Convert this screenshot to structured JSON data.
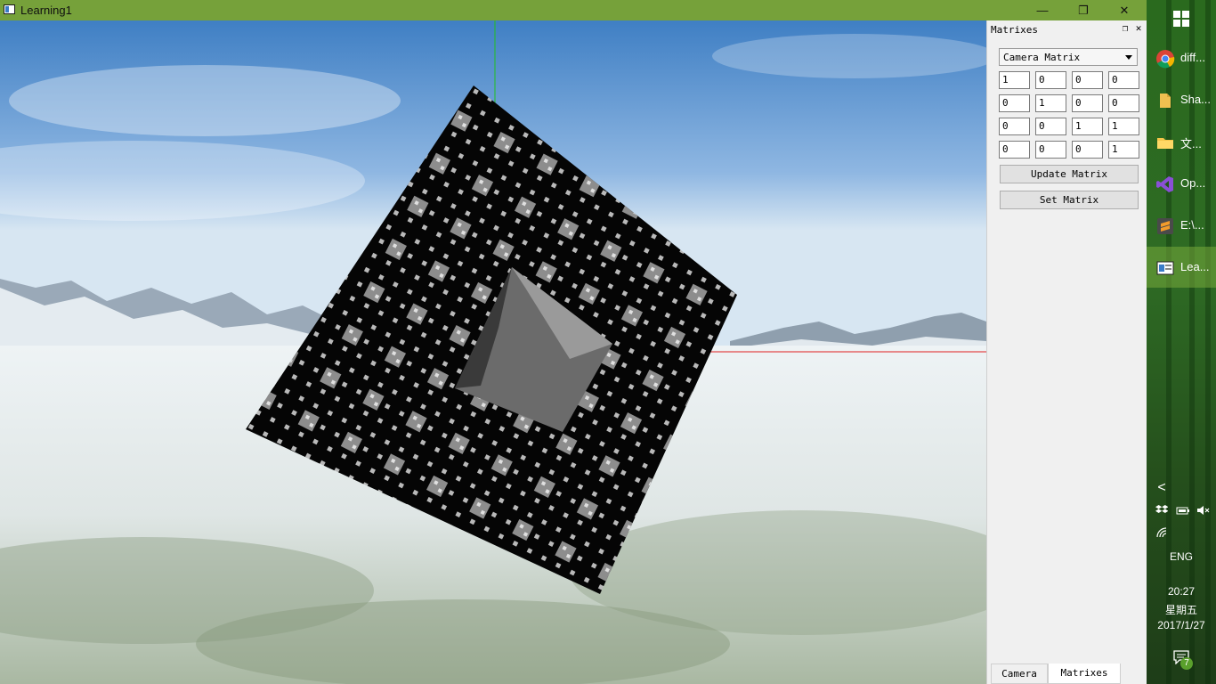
{
  "window": {
    "title": "Learning1",
    "minimize_glyph": "—",
    "maximize_glyph": "❐",
    "close_glyph": "✕"
  },
  "panel": {
    "title": "Matrixes",
    "float_glyph": "❐",
    "close_glyph": "✕",
    "dropdown": {
      "selected": "Camera Matrix"
    },
    "matrix": [
      [
        "1",
        "0",
        "0",
        "0"
      ],
      [
        "0",
        "1",
        "0",
        "0"
      ],
      [
        "0",
        "0",
        "1",
        "1"
      ],
      [
        "0",
        "0",
        "0",
        "1"
      ]
    ],
    "update_label": "Update Matrix",
    "set_label": "Set Matrix",
    "tabs": [
      {
        "label": "Camera",
        "active": false
      },
      {
        "label": "Matrixes",
        "active": true
      }
    ]
  },
  "taskbar": {
    "start_icon": "windows-logo-icon",
    "items": [
      {
        "label": "diff...",
        "icon": "chrome-icon",
        "active": false
      },
      {
        "label": "Sha...",
        "icon": "file-icon",
        "active": false
      },
      {
        "label": "文...",
        "icon": "folder-icon",
        "active": false
      },
      {
        "label": "Op...",
        "icon": "visual-studio-icon",
        "active": false
      },
      {
        "label": "E:\\...",
        "icon": "sublime-icon",
        "active": false
      },
      {
        "label": "Lea...",
        "icon": "app-window-icon",
        "active": true
      }
    ],
    "tray": {
      "chevron": "<",
      "language": "ENG",
      "time": "20:27",
      "weekday": "星期五",
      "date": "2017/1/27",
      "notification_count": "7"
    }
  }
}
